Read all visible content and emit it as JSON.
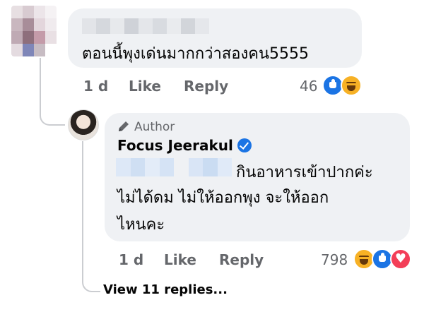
{
  "top_comment": {
    "text": "ตอนนี้พุงเด่นมากกว่าสองคน5555",
    "time": "1 d",
    "like_label": "Like",
    "reply_label": "Reply",
    "reaction_count": "46",
    "reactions": [
      "like-icon",
      "haha-icon"
    ]
  },
  "reply": {
    "badge": "Author",
    "author": "Focus Jeerakul",
    "text_line1": "กินอาหารเข้าปากค่ะ",
    "text_line2": "ไม่ได้ดม ไม่ให้ออกพุง จะให้ออก",
    "text_line3": "ไหนคะ",
    "time": "1 d",
    "like_label": "Like",
    "reply_label": "Reply",
    "reaction_count": "798",
    "reactions": [
      "haha-icon",
      "like-icon",
      "love-icon"
    ]
  },
  "view_replies": "View 11 replies...",
  "colors": {
    "bubble": "#eff1f4",
    "meta_text": "#65676b",
    "accent_blue": "#1b74e4",
    "haha": "#f7b125",
    "love": "#f33e58"
  }
}
